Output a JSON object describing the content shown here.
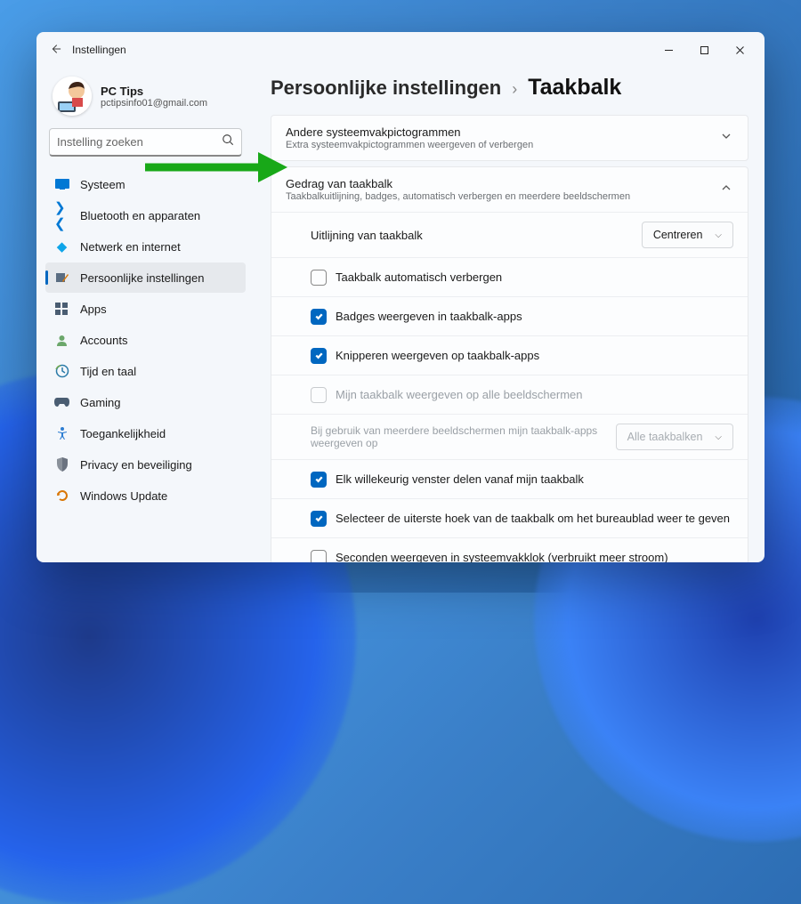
{
  "window": {
    "title": "Instellingen"
  },
  "profile": {
    "name": "PC Tips",
    "email": "pctipsinfo01@gmail.com"
  },
  "search": {
    "placeholder": "Instelling zoeken"
  },
  "sidebar": {
    "items": [
      {
        "label": "Systeem",
        "icon": "system"
      },
      {
        "label": "Bluetooth en apparaten",
        "icon": "bluetooth"
      },
      {
        "label": "Netwerk en internet",
        "icon": "wifi"
      },
      {
        "label": "Persoonlijke instellingen",
        "icon": "personalize",
        "active": true
      },
      {
        "label": "Apps",
        "icon": "apps"
      },
      {
        "label": "Accounts",
        "icon": "accounts"
      },
      {
        "label": "Tijd en taal",
        "icon": "time"
      },
      {
        "label": "Gaming",
        "icon": "gaming"
      },
      {
        "label": "Toegankelijkheid",
        "icon": "accessibility"
      },
      {
        "label": "Privacy en beveiliging",
        "icon": "privacy"
      },
      {
        "label": "Windows Update",
        "icon": "update"
      }
    ]
  },
  "breadcrumb": {
    "parent": "Persoonlijke instellingen",
    "current": "Taakbalk"
  },
  "cards": {
    "other_icons": {
      "title": "Andere systeemvakpictogrammen",
      "subtitle": "Extra systeemvakpictogrammen weergeven of verbergen"
    },
    "behavior": {
      "title": "Gedrag van taakbalk",
      "subtitle": "Taakbalkuitlijning, badges, automatisch verbergen en meerdere beeldschermen",
      "rows": {
        "alignment": {
          "label": "Uitlijning van taakbalk",
          "value": "Centreren"
        },
        "auto_hide": {
          "label": "Taakbalk automatisch verbergen",
          "checked": false
        },
        "badges": {
          "label": "Badges weergeven in taakbalk-apps",
          "checked": true
        },
        "flashing": {
          "label": "Knipperen weergeven op taakbalk-apps",
          "checked": true
        },
        "all_displays": {
          "label": "Mijn taakbalk weergeven op alle beeldschermen",
          "checked": false,
          "disabled": true
        },
        "multi_display": {
          "label": "Bij gebruik van meerdere beeldschermen mijn taakbalk-apps weergeven op",
          "value": "Alle taakbalken",
          "disabled": true
        },
        "share_window": {
          "label": "Elk willekeurig venster delen vanaf mijn taakbalk",
          "checked": true
        },
        "far_corner": {
          "label": "Selecteer de uiterste hoek van de taakbalk om het bureaublad weer te geven",
          "checked": true
        },
        "seconds": {
          "label": "Seconden weergeven in systeemvakklok (verbruikt meer stroom)",
          "checked": false
        }
      }
    }
  }
}
